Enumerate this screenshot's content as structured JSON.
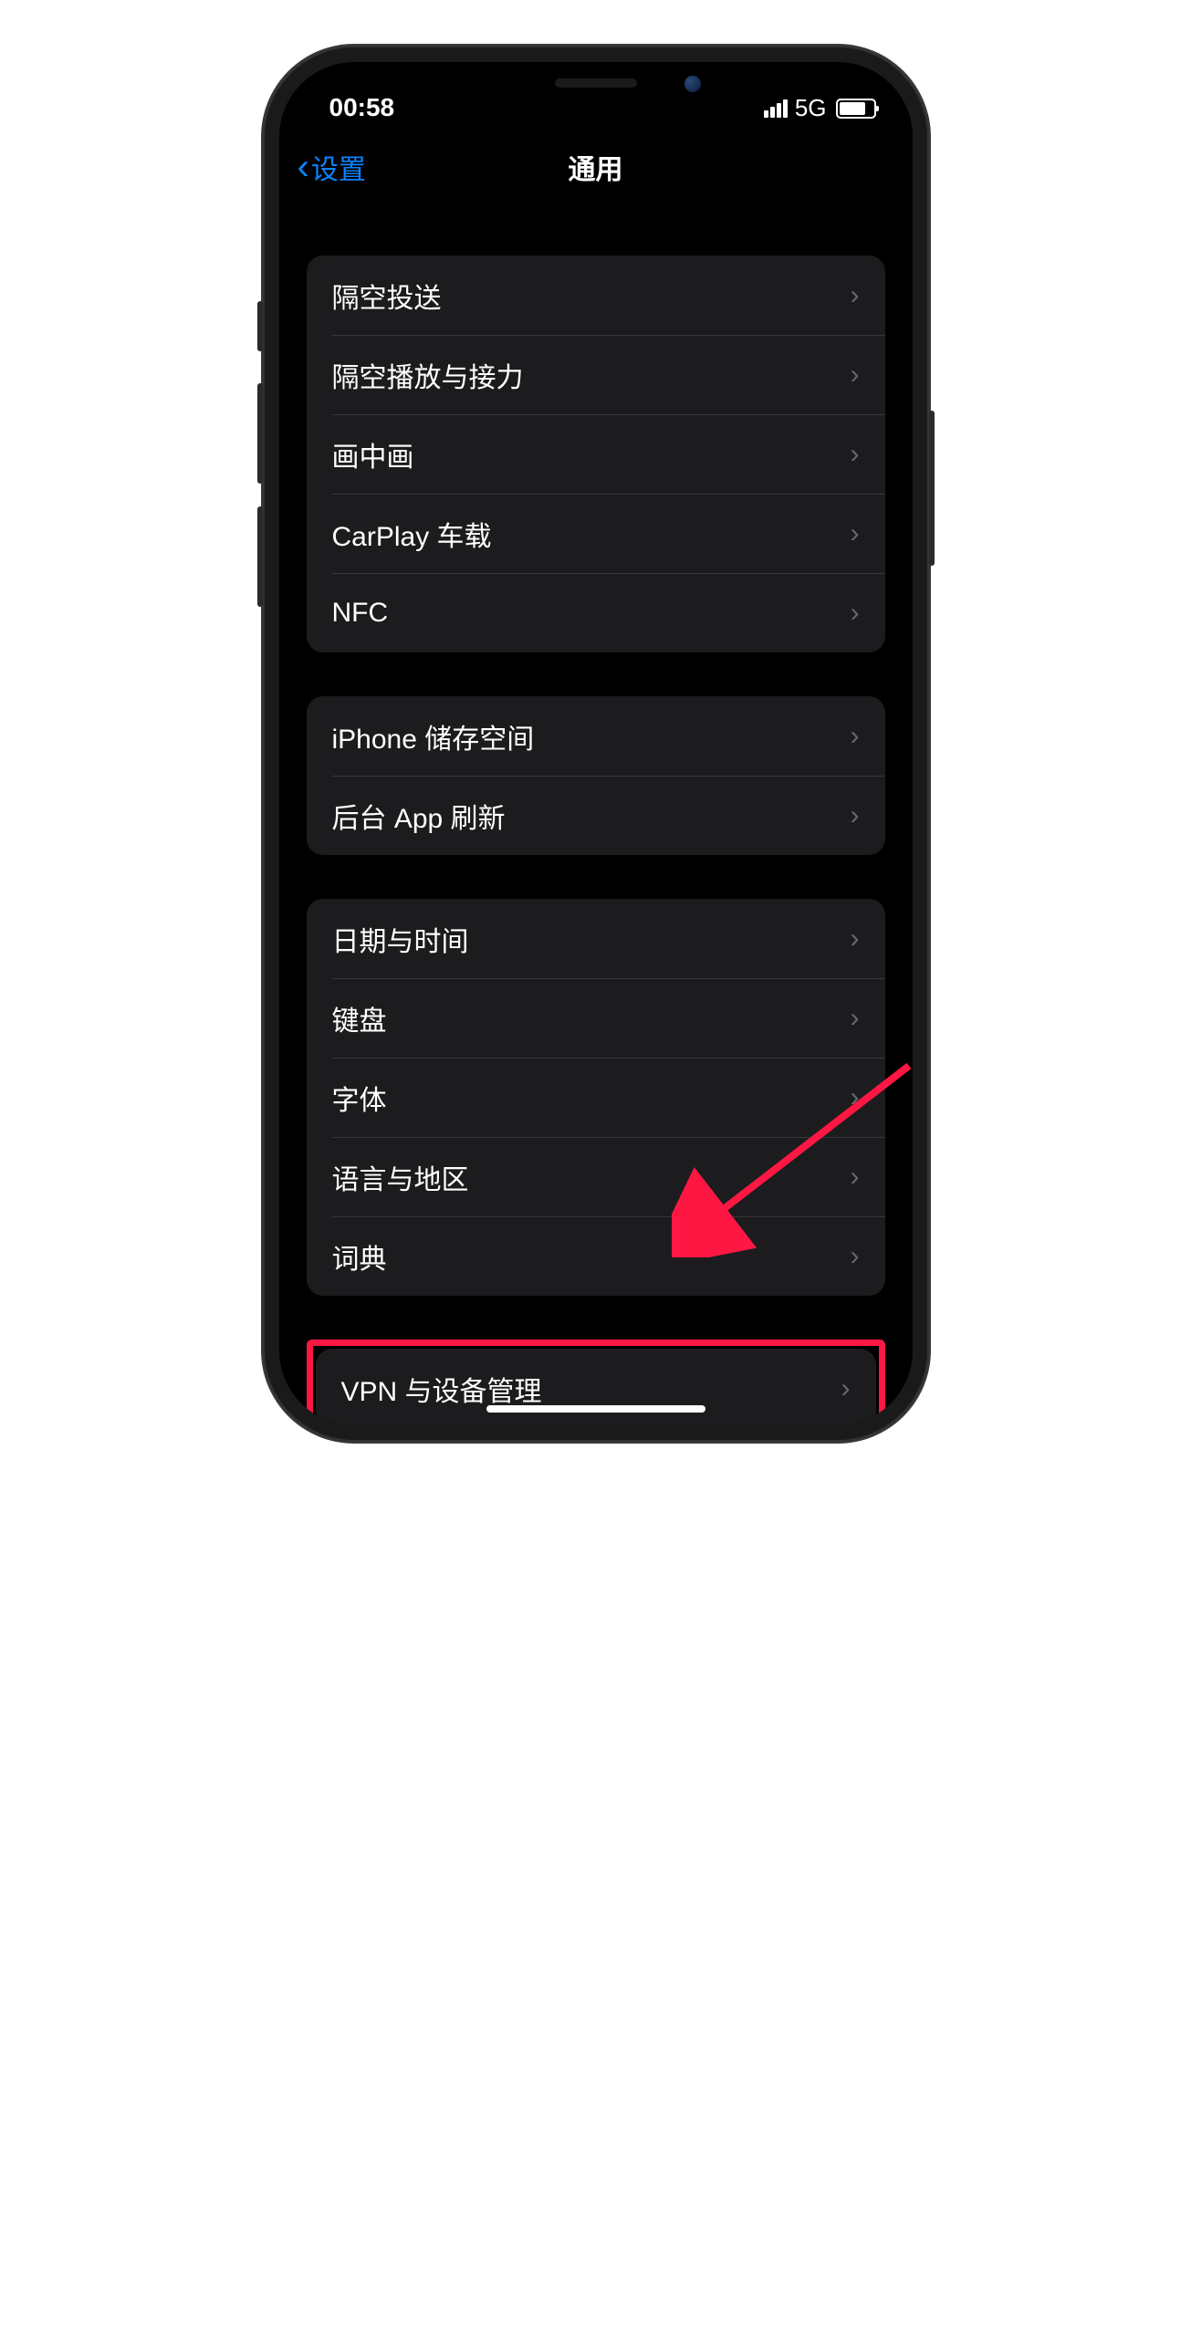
{
  "status": {
    "time": "00:58",
    "network": "5G"
  },
  "nav": {
    "back_label": "设置",
    "title": "通用"
  },
  "groups": [
    {
      "items": [
        {
          "label": "隔空投送",
          "name": "airdrop-row"
        },
        {
          "label": "隔空播放与接力",
          "name": "airplay-handoff-row"
        },
        {
          "label": "画中画",
          "name": "picture-in-picture-row"
        },
        {
          "label": "CarPlay 车载",
          "name": "carplay-row"
        },
        {
          "label": "NFC",
          "name": "nfc-row"
        }
      ]
    },
    {
      "items": [
        {
          "label": "iPhone 储存空间",
          "name": "iphone-storage-row"
        },
        {
          "label": "后台 App 刷新",
          "name": "background-app-refresh-row"
        }
      ]
    },
    {
      "items": [
        {
          "label": "日期与时间",
          "name": "date-time-row"
        },
        {
          "label": "键盘",
          "name": "keyboard-row"
        },
        {
          "label": "字体",
          "name": "fonts-row"
        },
        {
          "label": "语言与地区",
          "name": "language-region-row"
        },
        {
          "label": "词典",
          "name": "dictionary-row"
        }
      ]
    }
  ],
  "highlighted": {
    "label": "VPN 与设备管理",
    "name": "vpn-device-management-row"
  }
}
